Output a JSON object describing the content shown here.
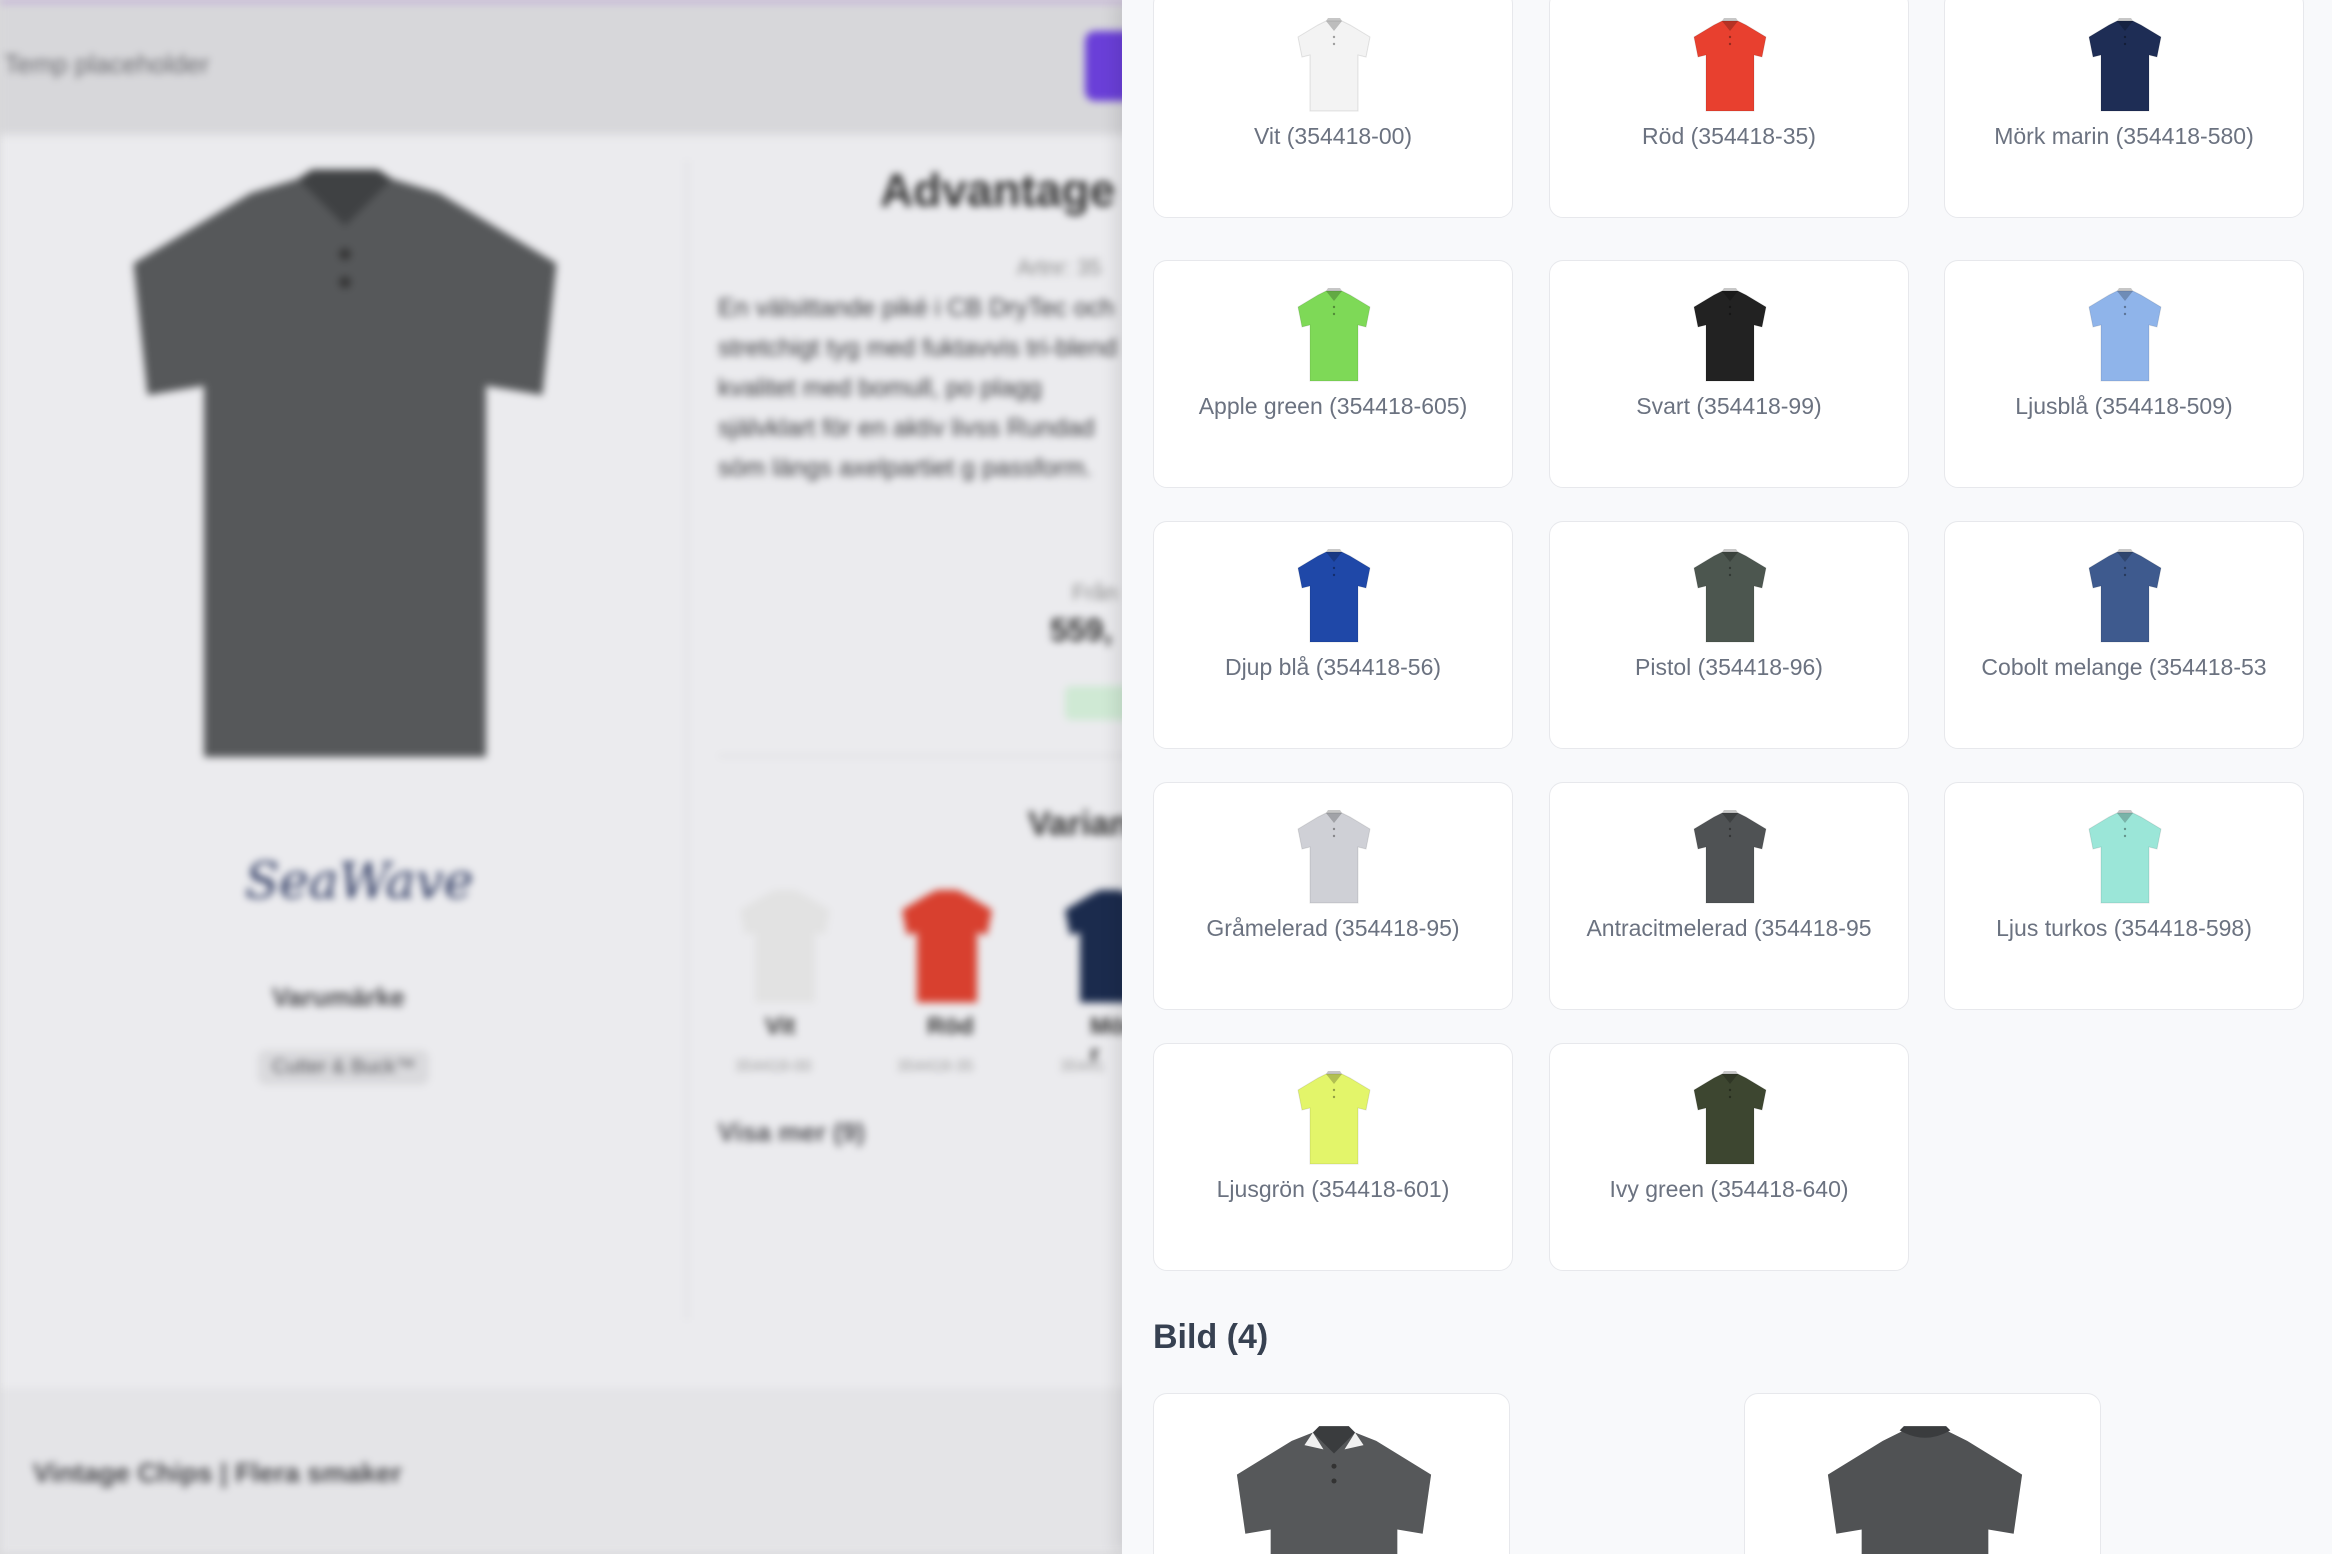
{
  "background": {
    "search_placeholder": "Temp placeholder",
    "product_title": "Advantage",
    "article_prefix": "Artnr: 35",
    "description": "En välsittande piké i CB DryTec och stretchigt tyg med fuktavvis tri-blend kvalitet med bomull, po plagg självklart för en aktiv livss Rundad söm längs axelpartiet g passform.",
    "from_label": "Från",
    "price": "559,",
    "brand_logo_text": "SeaWave",
    "brand_heading": "Varumärke",
    "brand_name": "Cutter & Buck™",
    "variants_heading": "Varian",
    "mini_variants": [
      {
        "label": "Vit",
        "sku": "354418-00",
        "color": "#e2e2e2"
      },
      {
        "label": "Röd",
        "sku": "354418-35",
        "color": "#d8402f"
      },
      {
        "label": "Mörk r",
        "sku": "35441",
        "color": "#1b2b4d"
      }
    ],
    "show_more": "Visa mer (9)",
    "footer_title": "Vintage Chips | Flera smaker"
  },
  "drawer": {
    "variants": [
      {
        "label": "Vit (354418-00)",
        "color": "#f3f3f3"
      },
      {
        "label": "Röd (354418-35)",
        "color": "#e8402f"
      },
      {
        "label": "Mörk marin (354418-580)",
        "color": "#1e2d55"
      },
      {
        "label": "Apple green (354418-605)",
        "color": "#7ed957"
      },
      {
        "label": "Svart (354418-99)",
        "color": "#222222"
      },
      {
        "label": "Ljusblå (354418-509)",
        "color": "#8fb4ea"
      },
      {
        "label": "Djup blå (354418-56)",
        "color": "#1f48a8"
      },
      {
        "label": "Pistol (354418-96)",
        "color": "#4c564f"
      },
      {
        "label": "Cobolt melange (354418-53",
        "color": "#3e5a8e"
      },
      {
        "label": "Gråmelerad (354418-95)",
        "color": "#cfd0d6"
      },
      {
        "label": "Antracitmelerad (354418-95",
        "color": "#4f5254"
      },
      {
        "label": "Ljus turkos (354418-598)",
        "color": "#9be6d8"
      },
      {
        "label": "Ljusgrön (354418-601)",
        "color": "#e3f56a"
      },
      {
        "label": "Ivy green (354418-640)",
        "color": "#3d4630"
      }
    ],
    "images_heading": "Bild (4)"
  },
  "colors": {
    "drawer_bg": "#f8f9fb",
    "card_border": "#e7e8ec",
    "label_text": "#6b7280",
    "accent_purple": "#6a3fd8",
    "product_gray": "#56585a"
  }
}
